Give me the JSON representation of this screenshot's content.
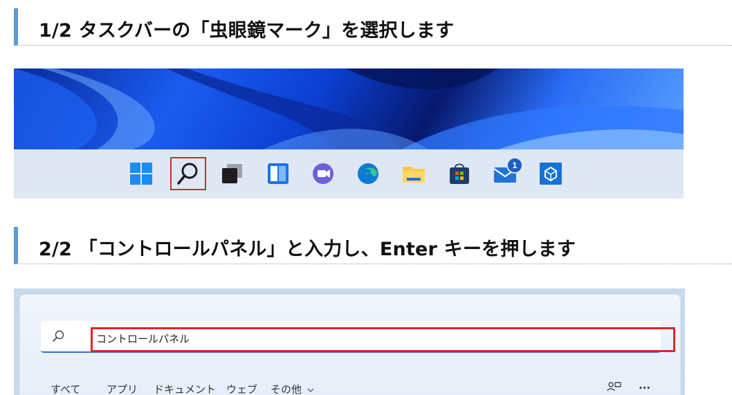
{
  "steps": [
    {
      "heading": "1/2 タスクバーの「虫眼鏡マーク」を選択します"
    },
    {
      "heading": "2/2 「コントロールパネル」と入力し、Enter キーを押します"
    }
  ],
  "taskbar": {
    "icons": [
      "windows-start-icon",
      "search-icon",
      "task-view-icon",
      "widgets-icon",
      "teams-chat-icon",
      "edge-icon",
      "file-explorer-icon",
      "microsoft-store-icon",
      "mail-icon",
      "azure-app-icon"
    ],
    "mail_badge": "1",
    "highlight_color": "#e0242b"
  },
  "search": {
    "value": "コントロールパネル",
    "tabs": [
      "すべて",
      "アプリ",
      "ドキュメント",
      "ウェブ",
      "その他"
    ],
    "more_label": "···"
  },
  "colors": {
    "accent": "#5b9bd5",
    "highlight": "#e0242b"
  }
}
